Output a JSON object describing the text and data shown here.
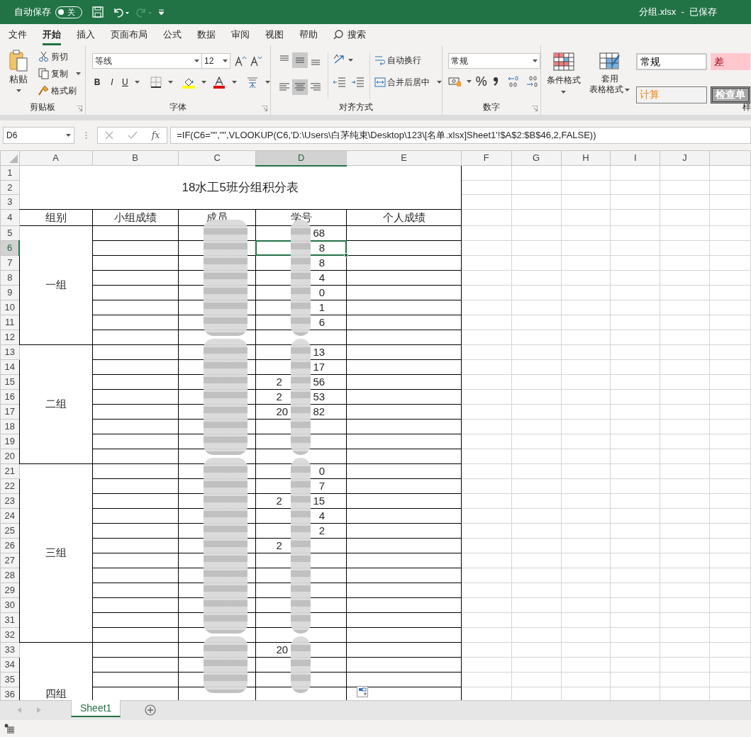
{
  "title_bar": {
    "autosave_label": "自动保存",
    "autosave_toggle": {
      "label": "关",
      "on": false
    },
    "file_title": "分组.xlsx  -  已保存"
  },
  "ribbon_tabs": [
    {
      "label": "文件",
      "selected": false
    },
    {
      "label": "开始",
      "selected": true
    },
    {
      "label": "插入",
      "selected": false
    },
    {
      "label": "页面布局",
      "selected": false
    },
    {
      "label": "公式",
      "selected": false
    },
    {
      "label": "数据",
      "selected": false
    },
    {
      "label": "审阅",
      "selected": false
    },
    {
      "label": "视图",
      "selected": false
    },
    {
      "label": "帮助",
      "selected": false
    }
  ],
  "search_label": "搜索",
  "ribbon": {
    "clipboard": {
      "paste": "粘贴",
      "cut": "剪切",
      "copy": "复制",
      "format_painter": "格式刷",
      "group_label": "剪贴板"
    },
    "font": {
      "font_name": "等线",
      "font_size": "12",
      "bold": "B",
      "italic": "I",
      "underline": "U",
      "group_label": "字体"
    },
    "alignment": {
      "wrap_text": "自动换行",
      "merge_center": "合并后居中",
      "group_label": "对齐方式"
    },
    "number": {
      "format": "常规",
      "percent": "%",
      "group_label": "数字"
    },
    "styles": {
      "conditional_format": "条件格式",
      "table_format": [
        "套用",
        "表格格式"
      ],
      "cell_styles": [
        {
          "label": "常规",
          "kind": "normal"
        },
        {
          "label": "差",
          "kind": "bad"
        },
        {
          "label": "计算",
          "kind": "calculation"
        },
        {
          "label": "检查单",
          "kind": "check"
        }
      ],
      "group_label": "样"
    }
  },
  "formula_bar": {
    "name_box": "D6",
    "function_label": "fx",
    "formula": "=IF(C6=\"\",\"\",VLOOKUP(C6,'D:\\Users\\白茅纯束\\Desktop\\123\\[名单.xlsx]Sheet1'!$A$2:$B$46,2,FALSE))"
  },
  "columns": [
    {
      "label": "A",
      "selected": false
    },
    {
      "label": "B",
      "selected": false
    },
    {
      "label": "C",
      "selected": false
    },
    {
      "label": "D",
      "selected": true
    },
    {
      "label": "E",
      "selected": false
    },
    {
      "label": "F",
      "selected": false
    },
    {
      "label": "G",
      "selected": false
    },
    {
      "label": "H",
      "selected": false
    },
    {
      "label": "I",
      "selected": false
    },
    {
      "label": "J",
      "selected": false
    }
  ],
  "row_headers": [
    {
      "label": "1",
      "selected": false
    },
    {
      "label": "2",
      "selected": false
    },
    {
      "label": "3",
      "selected": false
    },
    {
      "label": "4",
      "selected": false
    },
    {
      "label": "5",
      "selected": false
    },
    {
      "label": "6",
      "selected": true
    },
    {
      "label": "7",
      "selected": false
    },
    {
      "label": "8",
      "selected": false
    },
    {
      "label": "9",
      "selected": false
    },
    {
      "label": "10",
      "selected": false
    },
    {
      "label": "11",
      "selected": false
    },
    {
      "label": "12",
      "selected": false
    },
    {
      "label": "13",
      "selected": false
    },
    {
      "label": "14",
      "selected": false
    },
    {
      "label": "15",
      "selected": false
    },
    {
      "label": "16",
      "selected": false
    },
    {
      "label": "17",
      "selected": false
    },
    {
      "label": "18",
      "selected": false
    },
    {
      "label": "19",
      "selected": false
    },
    {
      "label": "20",
      "selected": false
    },
    {
      "label": "21",
      "selected": false
    },
    {
      "label": "22",
      "selected": false
    },
    {
      "label": "23",
      "selected": false
    },
    {
      "label": "24",
      "selected": false
    },
    {
      "label": "25",
      "selected": false
    },
    {
      "label": "26",
      "selected": false
    },
    {
      "label": "27",
      "selected": false
    },
    {
      "label": "28",
      "selected": false
    },
    {
      "label": "29",
      "selected": false
    },
    {
      "label": "30",
      "selected": false
    },
    {
      "label": "31",
      "selected": false
    },
    {
      "label": "32",
      "selected": false
    },
    {
      "label": "33",
      "selected": false
    },
    {
      "label": "34",
      "selected": false
    },
    {
      "label": "35",
      "selected": false
    },
    {
      "label": "36",
      "selected": false
    }
  ],
  "sheet": {
    "title": "18水工5班分组积分表",
    "headers": [
      "组别",
      "小组成绩",
      "成员",
      "学号",
      "个人成绩"
    ],
    "groups": [
      {
        "label": "一组",
        "rows": [
          {
            "suffix": "68",
            "selected": false
          },
          {
            "suffix": "8",
            "selected": true
          },
          {
            "suffix": "8",
            "selected": false
          },
          {
            "suffix": "4",
            "selected": false
          },
          {
            "suffix": "0",
            "selected": false
          },
          {
            "suffix": "1",
            "selected": false
          },
          {
            "suffix": "6",
            "selected": false
          },
          {
            "selected": false
          }
        ]
      },
      {
        "label": "二组",
        "rows": [
          {
            "suffix": "13",
            "selected": false
          },
          {
            "suffix": "17",
            "selected": false
          },
          {
            "prefix": "2",
            "suffix": "56",
            "selected": false
          },
          {
            "prefix": "2",
            "suffix": "53",
            "selected": false
          },
          {
            "prefix": "20",
            "suffix": "82",
            "selected": false
          },
          {
            "selected": false
          },
          {
            "selected": false
          },
          {
            "selected": false
          }
        ]
      },
      {
        "label": "三组",
        "rows": [
          {
            "suffix": "0",
            "selected": false
          },
          {
            "suffix": "7",
            "selected": false
          },
          {
            "prefix": "2",
            "suffix": "15",
            "selected": false
          },
          {
            "suffix": "4",
            "selected": false
          },
          {
            "suffix": "2",
            "selected": false
          },
          {
            "prefix": "2",
            "selected": false
          },
          {
            "selected": false
          },
          {
            "selected": false
          },
          {
            "selected": false
          },
          {
            "selected": false
          },
          {
            "selected": false
          },
          {
            "selected": false
          }
        ]
      },
      {
        "label": "四组",
        "rows": [
          {
            "prefix": "20",
            "selected": false
          },
          {
            "selected": false
          },
          {
            "selected": false
          },
          {
            "selected": false
          }
        ]
      }
    ]
  },
  "sheet_tabs": [
    {
      "label": "Sheet1",
      "selected": true
    }
  ]
}
